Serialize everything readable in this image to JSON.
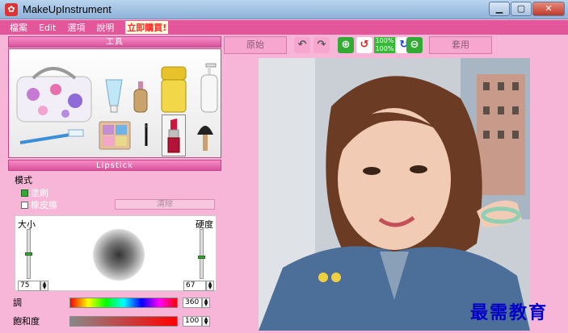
{
  "window": {
    "title": "MakeUpInstrument"
  },
  "menu": {
    "items": [
      "檔案",
      "Edit",
      "選項",
      "說明"
    ],
    "buy": "立即購買!"
  },
  "tools_panel": {
    "title": "工具"
  },
  "lipstick_panel": {
    "title": "Lipstick"
  },
  "mode": {
    "label": "模式",
    "brush": "塗刷",
    "eraser": "橡皮擦",
    "clear": "清除"
  },
  "brush": {
    "size_label": "大小",
    "hardness_label": "硬度",
    "size_value": "75",
    "hardness_value": "67"
  },
  "hue": {
    "label": "調",
    "value": "360"
  },
  "saturation": {
    "label": "飽和度",
    "value": "100"
  },
  "toolbar": {
    "original": "原始",
    "apply": "套用",
    "zoom_top": "100%",
    "zoom_bottom": "100%"
  },
  "watermark": "最需教育",
  "colors": {
    "accent": "#e4569a",
    "background": "#f7b6d8"
  }
}
